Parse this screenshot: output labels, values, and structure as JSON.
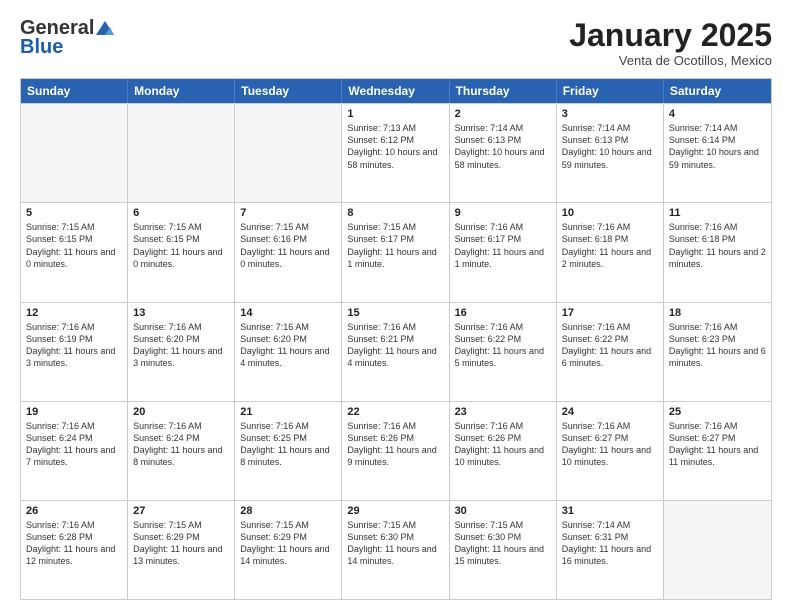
{
  "header": {
    "logo_general": "General",
    "logo_blue": "Blue",
    "month_title": "January 2025",
    "location": "Venta de Ocotillos, Mexico"
  },
  "weekdays": [
    "Sunday",
    "Monday",
    "Tuesday",
    "Wednesday",
    "Thursday",
    "Friday",
    "Saturday"
  ],
  "weeks": [
    [
      {
        "day": "",
        "empty": true
      },
      {
        "day": "",
        "empty": true
      },
      {
        "day": "",
        "empty": true
      },
      {
        "day": "1",
        "sunrise": "7:13 AM",
        "sunset": "6:12 PM",
        "daylight": "10 hours and 58 minutes."
      },
      {
        "day": "2",
        "sunrise": "7:14 AM",
        "sunset": "6:13 PM",
        "daylight": "10 hours and 58 minutes."
      },
      {
        "day": "3",
        "sunrise": "7:14 AM",
        "sunset": "6:13 PM",
        "daylight": "10 hours and 59 minutes."
      },
      {
        "day": "4",
        "sunrise": "7:14 AM",
        "sunset": "6:14 PM",
        "daylight": "10 hours and 59 minutes."
      }
    ],
    [
      {
        "day": "5",
        "sunrise": "7:15 AM",
        "sunset": "6:15 PM",
        "daylight": "11 hours and 0 minutes."
      },
      {
        "day": "6",
        "sunrise": "7:15 AM",
        "sunset": "6:15 PM",
        "daylight": "11 hours and 0 minutes."
      },
      {
        "day": "7",
        "sunrise": "7:15 AM",
        "sunset": "6:16 PM",
        "daylight": "11 hours and 0 minutes."
      },
      {
        "day": "8",
        "sunrise": "7:15 AM",
        "sunset": "6:17 PM",
        "daylight": "11 hours and 1 minute."
      },
      {
        "day": "9",
        "sunrise": "7:16 AM",
        "sunset": "6:17 PM",
        "daylight": "11 hours and 1 minute."
      },
      {
        "day": "10",
        "sunrise": "7:16 AM",
        "sunset": "6:18 PM",
        "daylight": "11 hours and 2 minutes."
      },
      {
        "day": "11",
        "sunrise": "7:16 AM",
        "sunset": "6:18 PM",
        "daylight": "11 hours and 2 minutes."
      }
    ],
    [
      {
        "day": "12",
        "sunrise": "7:16 AM",
        "sunset": "6:19 PM",
        "daylight": "11 hours and 3 minutes."
      },
      {
        "day": "13",
        "sunrise": "7:16 AM",
        "sunset": "6:20 PM",
        "daylight": "11 hours and 3 minutes."
      },
      {
        "day": "14",
        "sunrise": "7:16 AM",
        "sunset": "6:20 PM",
        "daylight": "11 hours and 4 minutes."
      },
      {
        "day": "15",
        "sunrise": "7:16 AM",
        "sunset": "6:21 PM",
        "daylight": "11 hours and 4 minutes."
      },
      {
        "day": "16",
        "sunrise": "7:16 AM",
        "sunset": "6:22 PM",
        "daylight": "11 hours and 5 minutes."
      },
      {
        "day": "17",
        "sunrise": "7:16 AM",
        "sunset": "6:22 PM",
        "daylight": "11 hours and 6 minutes."
      },
      {
        "day": "18",
        "sunrise": "7:16 AM",
        "sunset": "6:23 PM",
        "daylight": "11 hours and 6 minutes."
      }
    ],
    [
      {
        "day": "19",
        "sunrise": "7:16 AM",
        "sunset": "6:24 PM",
        "daylight": "11 hours and 7 minutes."
      },
      {
        "day": "20",
        "sunrise": "7:16 AM",
        "sunset": "6:24 PM",
        "daylight": "11 hours and 8 minutes."
      },
      {
        "day": "21",
        "sunrise": "7:16 AM",
        "sunset": "6:25 PM",
        "daylight": "11 hours and 8 minutes."
      },
      {
        "day": "22",
        "sunrise": "7:16 AM",
        "sunset": "6:26 PM",
        "daylight": "11 hours and 9 minutes."
      },
      {
        "day": "23",
        "sunrise": "7:16 AM",
        "sunset": "6:26 PM",
        "daylight": "11 hours and 10 minutes."
      },
      {
        "day": "24",
        "sunrise": "7:16 AM",
        "sunset": "6:27 PM",
        "daylight": "11 hours and 10 minutes."
      },
      {
        "day": "25",
        "sunrise": "7:16 AM",
        "sunset": "6:27 PM",
        "daylight": "11 hours and 11 minutes."
      }
    ],
    [
      {
        "day": "26",
        "sunrise": "7:16 AM",
        "sunset": "6:28 PM",
        "daylight": "11 hours and 12 minutes."
      },
      {
        "day": "27",
        "sunrise": "7:15 AM",
        "sunset": "6:29 PM",
        "daylight": "11 hours and 13 minutes."
      },
      {
        "day": "28",
        "sunrise": "7:15 AM",
        "sunset": "6:29 PM",
        "daylight": "11 hours and 14 minutes."
      },
      {
        "day": "29",
        "sunrise": "7:15 AM",
        "sunset": "6:30 PM",
        "daylight": "11 hours and 14 minutes."
      },
      {
        "day": "30",
        "sunrise": "7:15 AM",
        "sunset": "6:30 PM",
        "daylight": "11 hours and 15 minutes."
      },
      {
        "day": "31",
        "sunrise": "7:14 AM",
        "sunset": "6:31 PM",
        "daylight": "11 hours and 16 minutes."
      },
      {
        "day": "",
        "empty": true
      }
    ]
  ]
}
